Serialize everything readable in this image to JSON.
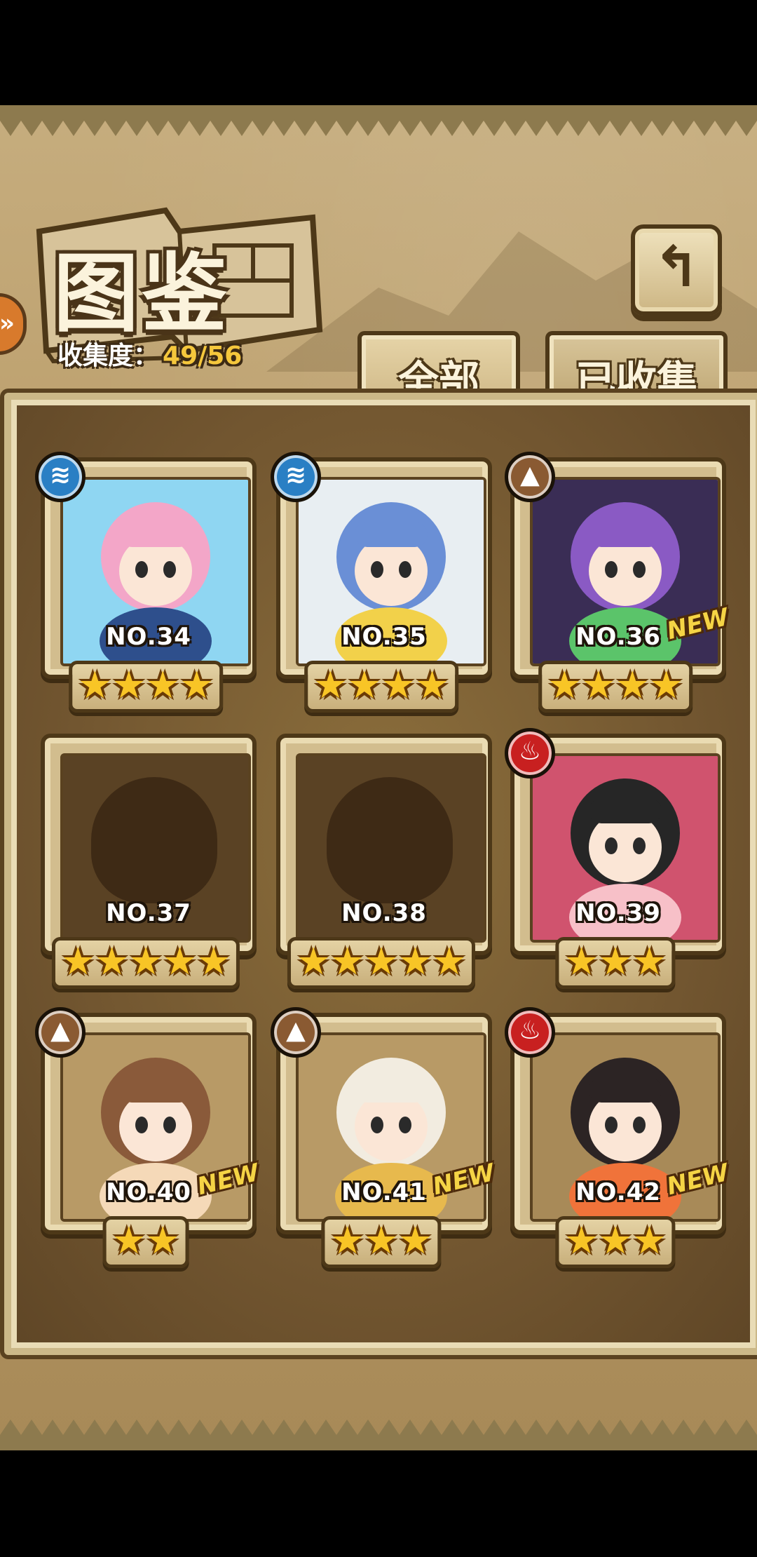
{
  "header": {
    "title": "图鉴",
    "collection_label": "收集度：",
    "collection_count": "49/56",
    "left_arrow_glyph": "»",
    "back_glyph": "↰"
  },
  "tabs": [
    {
      "label": "全部",
      "active": true
    },
    {
      "label": "已收集",
      "active": false
    }
  ],
  "colors": {
    "water": "#2a7fc4",
    "earth": "#8a5a32",
    "fire": "#c82020"
  },
  "cards": [
    {
      "number": "NO.34",
      "stars": "★★★★",
      "element": "water",
      "element_glyph": "≋",
      "new": "",
      "portrait": [
        "#8fd6f2",
        "#f3a6c8",
        "#2e4f8c"
      ]
    },
    {
      "number": "NO.35",
      "stars": "★★★★",
      "element": "water",
      "element_glyph": "≋",
      "new": "",
      "portrait": [
        "#e8eef2",
        "#6a8fd6",
        "#f2d14a"
      ]
    },
    {
      "number": "NO.36",
      "stars": "★★★★",
      "element": "earth",
      "element_glyph": "▲",
      "new": "NEW",
      "portrait": [
        "#3a2d55",
        "#8a5ac4",
        "#5bc46a"
      ]
    },
    {
      "number": "NO.37",
      "stars": "★★★★★",
      "element": "",
      "element_glyph": "",
      "new": "",
      "portrait": null
    },
    {
      "number": "NO.38",
      "stars": "★★★★★",
      "element": "",
      "element_glyph": "",
      "new": "",
      "portrait": null
    },
    {
      "number": "NO.39",
      "stars": "★★★",
      "element": "fire",
      "element_glyph": "♨",
      "new": "",
      "portrait": [
        "#d0536e",
        "#262626",
        "#f7c0c8"
      ]
    },
    {
      "number": "NO.40",
      "stars": "★★",
      "element": "earth",
      "element_glyph": "▲",
      "new": "NEW",
      "portrait": [
        "#b89a66",
        "#8a5a3a",
        "#f5d9b8"
      ]
    },
    {
      "number": "NO.41",
      "stars": "★★★",
      "element": "earth",
      "element_glyph": "▲",
      "new": "NEW",
      "portrait": [
        "#b89a66",
        "#f2ece0",
        "#e7b94d"
      ]
    },
    {
      "number": "NO.42",
      "stars": "★★★",
      "element": "fire",
      "element_glyph": "♨",
      "new": "NEW",
      "portrait": [
        "#a88a58",
        "#2c2424",
        "#f0733a"
      ]
    }
  ]
}
